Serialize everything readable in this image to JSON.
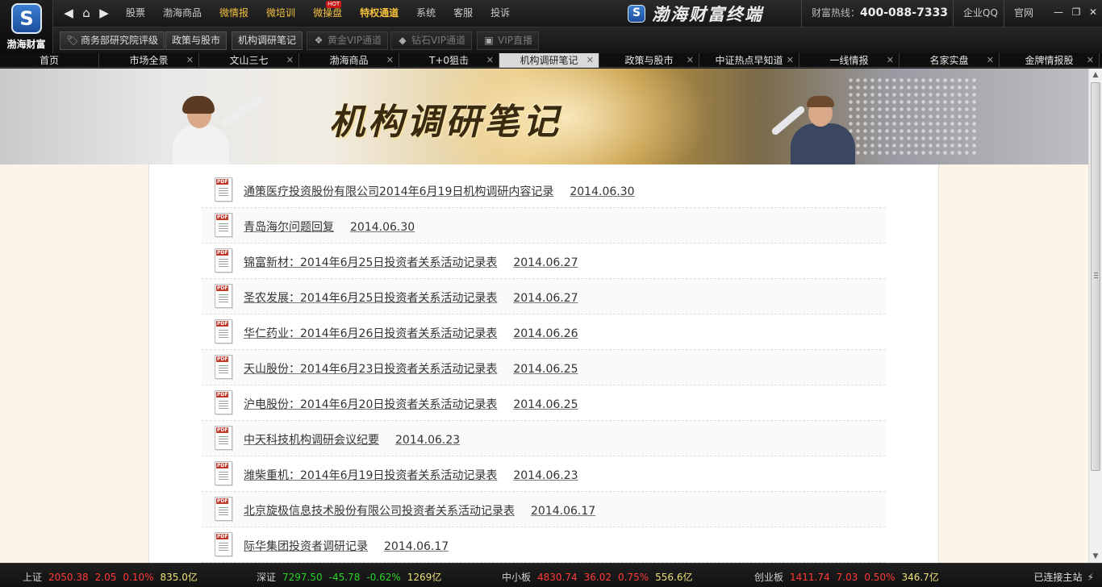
{
  "app": {
    "logo_text": "渤海财富",
    "brand_name": "渤海财富终端",
    "hotline_label": "财富热线：",
    "hotline_number": "400-088-7333",
    "links": [
      "企业QQ",
      "官网"
    ]
  },
  "menu": [
    {
      "label": "股票",
      "style": "normal"
    },
    {
      "label": "渤海商品",
      "style": "normal"
    },
    {
      "label": "微情报",
      "style": "gold"
    },
    {
      "label": "微培训",
      "style": "gold"
    },
    {
      "label": "微操盘",
      "style": "gold",
      "badge": "HOT"
    },
    {
      "label": "特权通道",
      "style": "hot"
    },
    {
      "label": "系统",
      "style": "normal"
    },
    {
      "label": "客服",
      "style": "normal"
    },
    {
      "label": "投诉",
      "style": "normal"
    }
  ],
  "toolbar": [
    {
      "label": "商务部研究院评级",
      "icon": "tag-icon",
      "dim": false
    },
    {
      "label": "政策与股市",
      "icon": "",
      "dim": false
    },
    {
      "label": "机构调研笔记",
      "icon": "",
      "dim": false
    },
    {
      "label": "黄金VIP通道",
      "icon": "shield-icon",
      "dim": true
    },
    {
      "label": "钻石VIP通道",
      "icon": "diamond-icon",
      "dim": true
    },
    {
      "label": "VIP直播",
      "icon": "tv-icon",
      "dim": true
    }
  ],
  "tabs": [
    {
      "label": "首页",
      "closable": false,
      "active": false
    },
    {
      "label": "市场全景",
      "closable": true,
      "active": false
    },
    {
      "label": "文山三七",
      "closable": true,
      "active": false
    },
    {
      "label": "渤海商品",
      "closable": true,
      "active": false
    },
    {
      "label": "T+0狙击",
      "closable": true,
      "active": false
    },
    {
      "label": "机构调研笔记",
      "closable": true,
      "active": true
    },
    {
      "label": "政策与股市",
      "closable": true,
      "active": false
    },
    {
      "label": "中证热点早知道",
      "closable": true,
      "active": false
    },
    {
      "label": "一线情报",
      "closable": true,
      "active": false
    },
    {
      "label": "名家实盘",
      "closable": true,
      "active": false
    },
    {
      "label": "金牌情报股",
      "closable": true,
      "active": false
    }
  ],
  "banner": {
    "title": "机构调研笔记"
  },
  "documents": [
    {
      "title": "通策医疗投资股份有限公司2014年6月19日机构调研内容记录",
      "date": "2014.06.30"
    },
    {
      "title": "青岛海尔问题回复",
      "date": "2014.06.30"
    },
    {
      "title": "锦富新材：2014年6月25日投资者关系活动记录表",
      "date": "2014.06.27"
    },
    {
      "title": "圣农发展：2014年6月25日投资者关系活动记录表",
      "date": "2014.06.27"
    },
    {
      "title": "华仁药业：2014年6月26日投资者关系活动记录表",
      "date": "2014.06.26"
    },
    {
      "title": "天山股份：2014年6月23日投资者关系活动记录表",
      "date": "2014.06.25"
    },
    {
      "title": "沪电股份：2014年6月20日投资者关系活动记录表",
      "date": "2014.06.25"
    },
    {
      "title": "中天科技机构调研会议纪要",
      "date": "2014.06.23"
    },
    {
      "title": "潍柴重机：2014年6月19日投资者关系活动记录表",
      "date": "2014.06.23"
    },
    {
      "title": "北京旋极信息技术股份有限公司投资者关系活动记录表",
      "date": "2014.06.17"
    },
    {
      "title": "际华集团投资者调研记录",
      "date": "2014.06.17"
    }
  ],
  "indices": [
    {
      "name": "上证",
      "value": "2050.38",
      "change": "2.05",
      "pct": "0.10%",
      "volume": "835.0亿",
      "direction": "up"
    },
    {
      "name": "深证",
      "value": "7297.50",
      "change": "-45.78",
      "pct": "-0.62%",
      "volume": "1269亿",
      "direction": "down"
    },
    {
      "name": "中小板",
      "value": "4830.74",
      "change": "36.02",
      "pct": "0.75%",
      "volume": "556.6亿",
      "direction": "up"
    },
    {
      "name": "创业板",
      "value": "1411.74",
      "change": "7.03",
      "pct": "0.50%",
      "volume": "346.7亿",
      "direction": "up"
    }
  ],
  "status": {
    "connection": "已连接主站"
  }
}
